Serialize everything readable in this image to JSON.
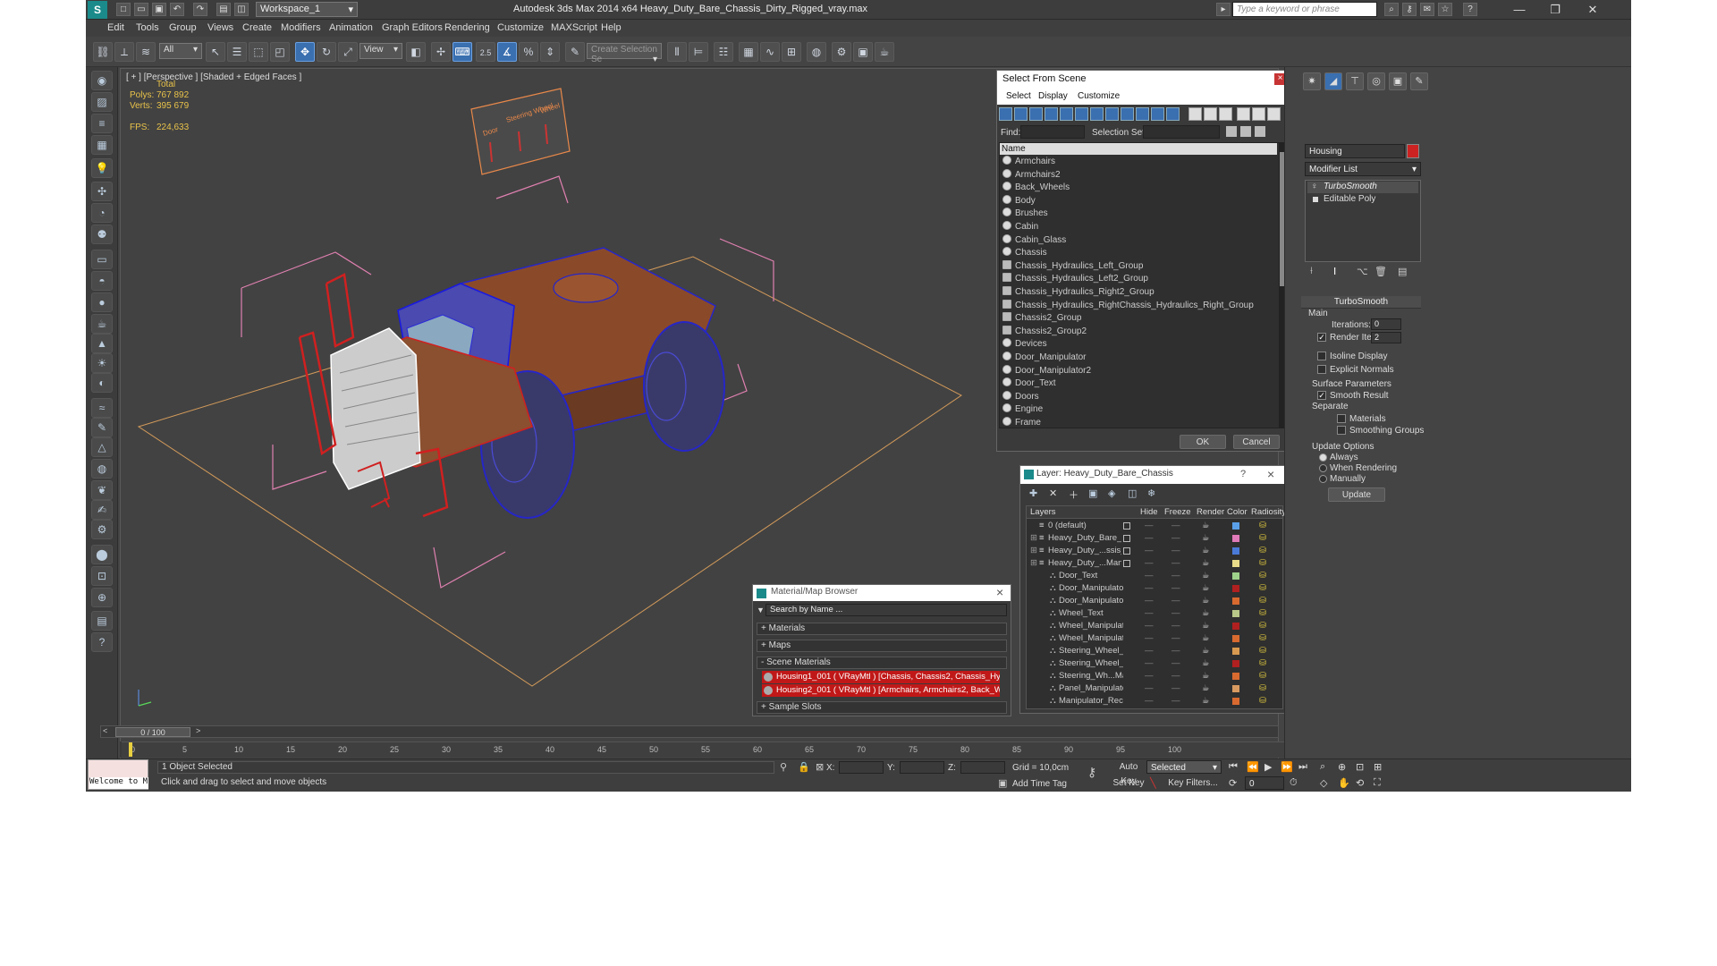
{
  "window": {
    "title": "Autodesk 3ds Max  2014 x64     Heavy_Duty_Bare_Chassis_Dirty_Rigged_vray.max",
    "workspace": "Workspace_1",
    "search_placeholder": "Type a keyword or phrase",
    "minimize": "—",
    "maximize": "❐",
    "close": "✕"
  },
  "menu": [
    "Edit",
    "Tools",
    "Group",
    "Views",
    "Create",
    "Modifiers",
    "Animation",
    "Graph Editors",
    "Rendering",
    "Customize",
    "MAXScript",
    "Help"
  ],
  "toolbar": {
    "selection_filter": "All",
    "ref_coord": "View",
    "selection_set_placeholder": "Create Selection Se",
    "snap_value": "2.5"
  },
  "viewport": {
    "label": "[ + ] [Perspective ] [Shaded + Edged Faces ]",
    "stats": {
      "total_label": "Total",
      "polys_label": "Polys:",
      "polys_value": "767 892",
      "verts_label": "Verts:",
      "verts_value": "395 679",
      "fps_label": "FPS:",
      "fps_value": "224,633"
    },
    "board_labels": [
      "Door",
      "Steering Wheel",
      "Wheel"
    ]
  },
  "select_from_scene": {
    "title": "Select From Scene",
    "menu": [
      "Select",
      "Display",
      "Customize"
    ],
    "find_label": "Find:",
    "selection_set_label": "Selection Set:",
    "column_header": "Name",
    "items": [
      {
        "name": "Armchairs",
        "group": false
      },
      {
        "name": "Armchairs2",
        "group": false
      },
      {
        "name": "Back_Wheels",
        "group": false
      },
      {
        "name": "Body",
        "group": false
      },
      {
        "name": "Brushes",
        "group": false
      },
      {
        "name": "Cabin",
        "group": false
      },
      {
        "name": "Cabin_Glass",
        "group": false
      },
      {
        "name": "Chassis",
        "group": false
      },
      {
        "name": "Chassis_Hydraulics_Left_Group",
        "group": true
      },
      {
        "name": "Chassis_Hydraulics_Left2_Group",
        "group": true
      },
      {
        "name": "Chassis_Hydraulics_Right2_Group",
        "group": true
      },
      {
        "name": "Chassis_Hydraulics_RightChassis_Hydraulics_Right_Group",
        "group": true
      },
      {
        "name": "Chassis2_Group",
        "group": true
      },
      {
        "name": "Chassis2_Group2",
        "group": true
      },
      {
        "name": "Devices",
        "group": false
      },
      {
        "name": "Door_Manipulator",
        "group": false
      },
      {
        "name": "Door_Manipulator2",
        "group": false
      },
      {
        "name": "Door_Text",
        "group": false
      },
      {
        "name": "Doors",
        "group": false
      },
      {
        "name": "Engine",
        "group": false
      },
      {
        "name": "Frame",
        "group": false
      }
    ],
    "ok": "OK",
    "cancel": "Cancel"
  },
  "layer_window": {
    "title": "Layer: Heavy_Duty_Bare_Chassis",
    "help": "?",
    "columns": [
      "Layers",
      "Hide",
      "Freeze",
      "Render",
      "Color",
      "Radiosity"
    ],
    "rows": [
      {
        "name": "0 (default)",
        "indent": 1,
        "color": "#5aa0e8"
      },
      {
        "name": "Heavy_Duty_Bare_Ch",
        "indent": 1,
        "color": "#e07ab8"
      },
      {
        "name": "Heavy_Duty_...ssis_H",
        "indent": 1,
        "color": "#4a7ad8"
      },
      {
        "name": "Heavy_Duty_...Manip",
        "indent": 1,
        "color": "#e8dc8a"
      },
      {
        "name": "Door_Text",
        "indent": 2,
        "color": "#9ed28a"
      },
      {
        "name": "Door_Manipulator",
        "indent": 2,
        "color": "#b02020"
      },
      {
        "name": "Door_Manipulator2",
        "indent": 2,
        "color": "#d86a30"
      },
      {
        "name": "Wheel_Text",
        "indent": 2,
        "color": "#b8c888"
      },
      {
        "name": "Wheel_Manipulator",
        "indent": 2,
        "color": "#b02020"
      },
      {
        "name": "Wheel_Manipulator",
        "indent": 2,
        "color": "#d86a30"
      },
      {
        "name": "Steering_Wheel_Te",
        "indent": 2,
        "color": "#d89a50"
      },
      {
        "name": "Steering_Wheel_M",
        "indent": 2,
        "color": "#b02020"
      },
      {
        "name": "Steering_Wh...Mar",
        "indent": 2,
        "color": "#d86a30"
      },
      {
        "name": "Panel_Manipulator",
        "indent": 2,
        "color": "#d89a60"
      },
      {
        "name": "Manipulator_Recta",
        "indent": 2,
        "color": "#d86a30"
      }
    ]
  },
  "material_browser": {
    "title": "Material/Map Browser",
    "search_placeholder": "Search by Name ...",
    "sections": [
      "+ Materials",
      "+ Maps",
      "- Scene Materials",
      "+ Sample Slots"
    ],
    "materials": [
      "Housing1_001 ( VRayMtl ) [Chassis, Chassis2, Chassis_Hydrauli...",
      "Housing2_001 ( VRayMtl ) [Armchairs, Armchairs2, Back_Wheel..."
    ]
  },
  "command_panel": {
    "object_name": "Housing",
    "object_color": "#cc2222",
    "modifier_list": "Modifier List",
    "stack": [
      "TurboSmooth",
      "Editable Poly"
    ],
    "rollout_title": "TurboSmooth",
    "main_label": "Main",
    "iterations_label": "Iterations:",
    "iterations_value": "0",
    "render_iters_label": "Render Iters:",
    "render_iters_value": "2",
    "isoline_label": "Isoline Display",
    "explicit_label": "Explicit Normals",
    "surface_label": "Surface Parameters",
    "smooth_result_label": "Smooth Result",
    "separate_label": "Separate",
    "materials_label": "Materials",
    "smoothing_groups_label": "Smoothing Groups",
    "update_options_label": "Update Options",
    "always_label": "Always",
    "when_rendering_label": "When Rendering",
    "manually_label": "Manually",
    "update_button": "Update"
  },
  "timeline": {
    "frame": "0 / 100",
    "ticks": [
      "0",
      "5",
      "10",
      "15",
      "20",
      "25",
      "30",
      "35",
      "40",
      "45",
      "50",
      "55",
      "60",
      "65",
      "70",
      "75",
      "80",
      "85",
      "90",
      "95",
      "100"
    ]
  },
  "status": {
    "maxscript": "Welcome to M",
    "selected": "1 Object Selected",
    "prompt": "Click and drag to select and move objects",
    "x_label": "X:",
    "y_label": "Y:",
    "z_label": "Z:",
    "grid": "Grid = 10,0cm",
    "add_time_tag": "Add Time Tag",
    "auto_key": "Auto Key",
    "set_key": "Set Key",
    "selected_dd": "Selected",
    "key_filters": "Key Filters...",
    "frame_value": "0"
  }
}
